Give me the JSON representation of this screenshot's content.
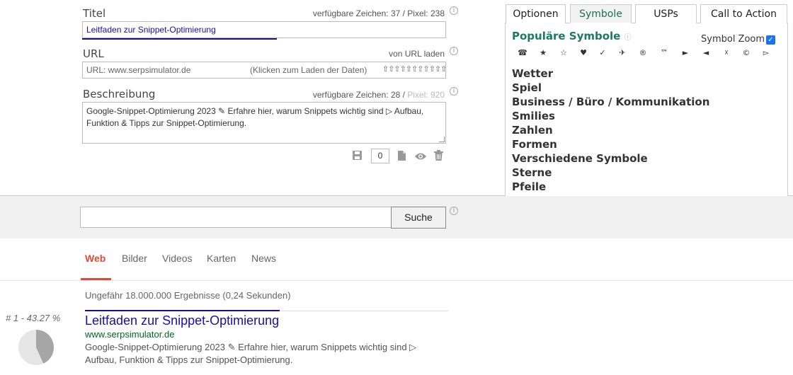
{
  "editor": {
    "title": {
      "label": "Titel",
      "meta": "verfügbare Zeichen: 37 / Pixel: 238",
      "value": "Leitfaden zur Snippet-Optimierung"
    },
    "url": {
      "label": "URL",
      "meta": "von URL laden",
      "placeholder": "URL: www.serpsimulator.de",
      "hint": "(Klicken zum Laden der Daten)",
      "arrows": "⇧⇧⇧⇧⇧⇧⇧⇧⇧⇧⇧"
    },
    "description": {
      "label": "Beschreibung",
      "meta_main": "verfügbare Zeichen: 28 / ",
      "meta_dim": "Pixel: 920",
      "value": "Google-Snippet-Optimierung 2023 ✎ Erfahre hier, warum Snippets wichtig sind ▷ Aufbau, Funktion & Tipps zur Snippet-Optimierung."
    },
    "counter": "0"
  },
  "panel": {
    "tabs": [
      "Optionen",
      "Symbole",
      "USPs",
      "Call to Action"
    ],
    "active_tab": "Symbole",
    "title": "Populäre Symbole",
    "zoom_label": "Symbol Zoom",
    "zoom_checked": true,
    "symbols": [
      "☎",
      "★",
      "☆",
      "♥",
      "✓",
      "✈",
      "®",
      "™",
      "►",
      "◄",
      "☓",
      "©",
      "▻"
    ],
    "categories": [
      "Wetter",
      "Spiel",
      "Business / Büro / Kommunikation",
      "Smilies",
      "Zahlen",
      "Formen",
      "Verschiedene Symbole",
      "Sterne",
      "Pfeile"
    ]
  },
  "search": {
    "button": "Suche"
  },
  "nav": {
    "tabs": [
      "Web",
      "Bilder",
      "Videos",
      "Karten",
      "News"
    ],
    "active": "Web"
  },
  "results": {
    "count": "Ungefähr 18.000.000 Ergebnisse (0,24 Sekunden)",
    "rank": "# 1 - 43.27 %",
    "rank_percent": 43.27,
    "title": "Leitfaden zur Snippet-Optimierung",
    "url": "www.serpsimulator.de",
    "description": "Google-Snippet-Optimierung 2023 ✎ Erfahre hier, warum Snippets wichtig sind ▷ Aufbau, Funktion & Tipps zur Snippet-Optimierung."
  },
  "colors": {
    "accent_green": "#1c7a5f",
    "link_blue": "#1a0dab",
    "url_green": "#006621",
    "nav_red": "#dd4b39"
  }
}
